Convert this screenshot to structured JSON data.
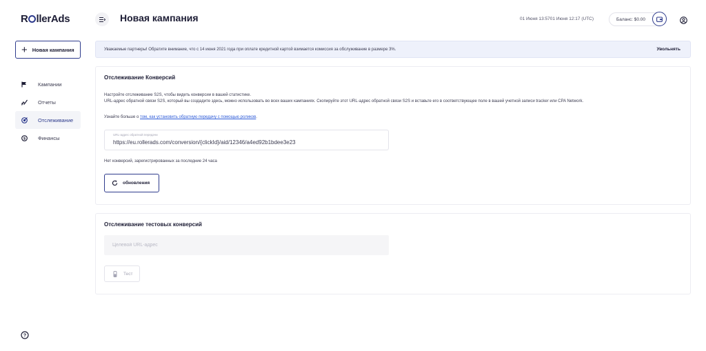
{
  "app": {
    "logo_prefix": "R",
    "logo_suffix": "llerAds"
  },
  "sidebar": {
    "new_campaign_label": "Новая кампания",
    "items": [
      {
        "label": "Кампании",
        "icon": "flag-icon",
        "active": false
      },
      {
        "label": "Отчеты",
        "icon": "chart-icon",
        "active": false
      },
      {
        "label": "Отслеживание",
        "icon": "tracking-icon",
        "active": true
      },
      {
        "label": "Финансы",
        "icon": "dollar-icon",
        "active": false
      }
    ]
  },
  "header": {
    "title": "Новая кампания",
    "time": "01 Июня 13:5701 Июня 12:17 (UTC)",
    "balance": "Баланс: $0.00"
  },
  "notice": {
    "text": "Уважаемые партнеры! Обратите внимание, что с 14 июня 2021 года при оплате кредитной картой взимается комиссия за обслуживание в размере 3%.",
    "dismiss_label": "Увольнять"
  },
  "conversion_tracking": {
    "title": "Отслеживание Конверсий",
    "desc_line1": "Настройте отслеживание S2S, чтобы видеть конверсии в вашей статистике.",
    "desc_line2": "URL-адрес обратной связи S2S, который вы создадите здесь, можно использовать во всех ваших кампаниях. Скопируйте этот URL-адрес обратной связи S2S и вставьте его в соответствующее поле в вашей учетной записи tracker или CPA Network.",
    "learn_more_prefix": "Узнайте больше о ",
    "learn_more_link": "том, как установить обратную передачу с помощью роликов",
    "learn_more_suffix": ".",
    "url_label": "URL-адрес обратной передачи",
    "url_value": "https://eu.rollerads.com/conversion/{clickId}/aid/12346/a4ed92b1bdee3e23",
    "no_conversions": "Нет конверсий, зарегистрированных за последние 24 часа",
    "refresh_label": "обновления"
  },
  "test_tracking": {
    "title": "Отслеживание тестовых конверсий",
    "target_placeholder": "Целевой URL-адрес",
    "test_label": "Тест"
  },
  "colors": {
    "accent": "#2d3a8c",
    "notice_bg": "#eef1fb",
    "link": "#2d5bd8"
  }
}
